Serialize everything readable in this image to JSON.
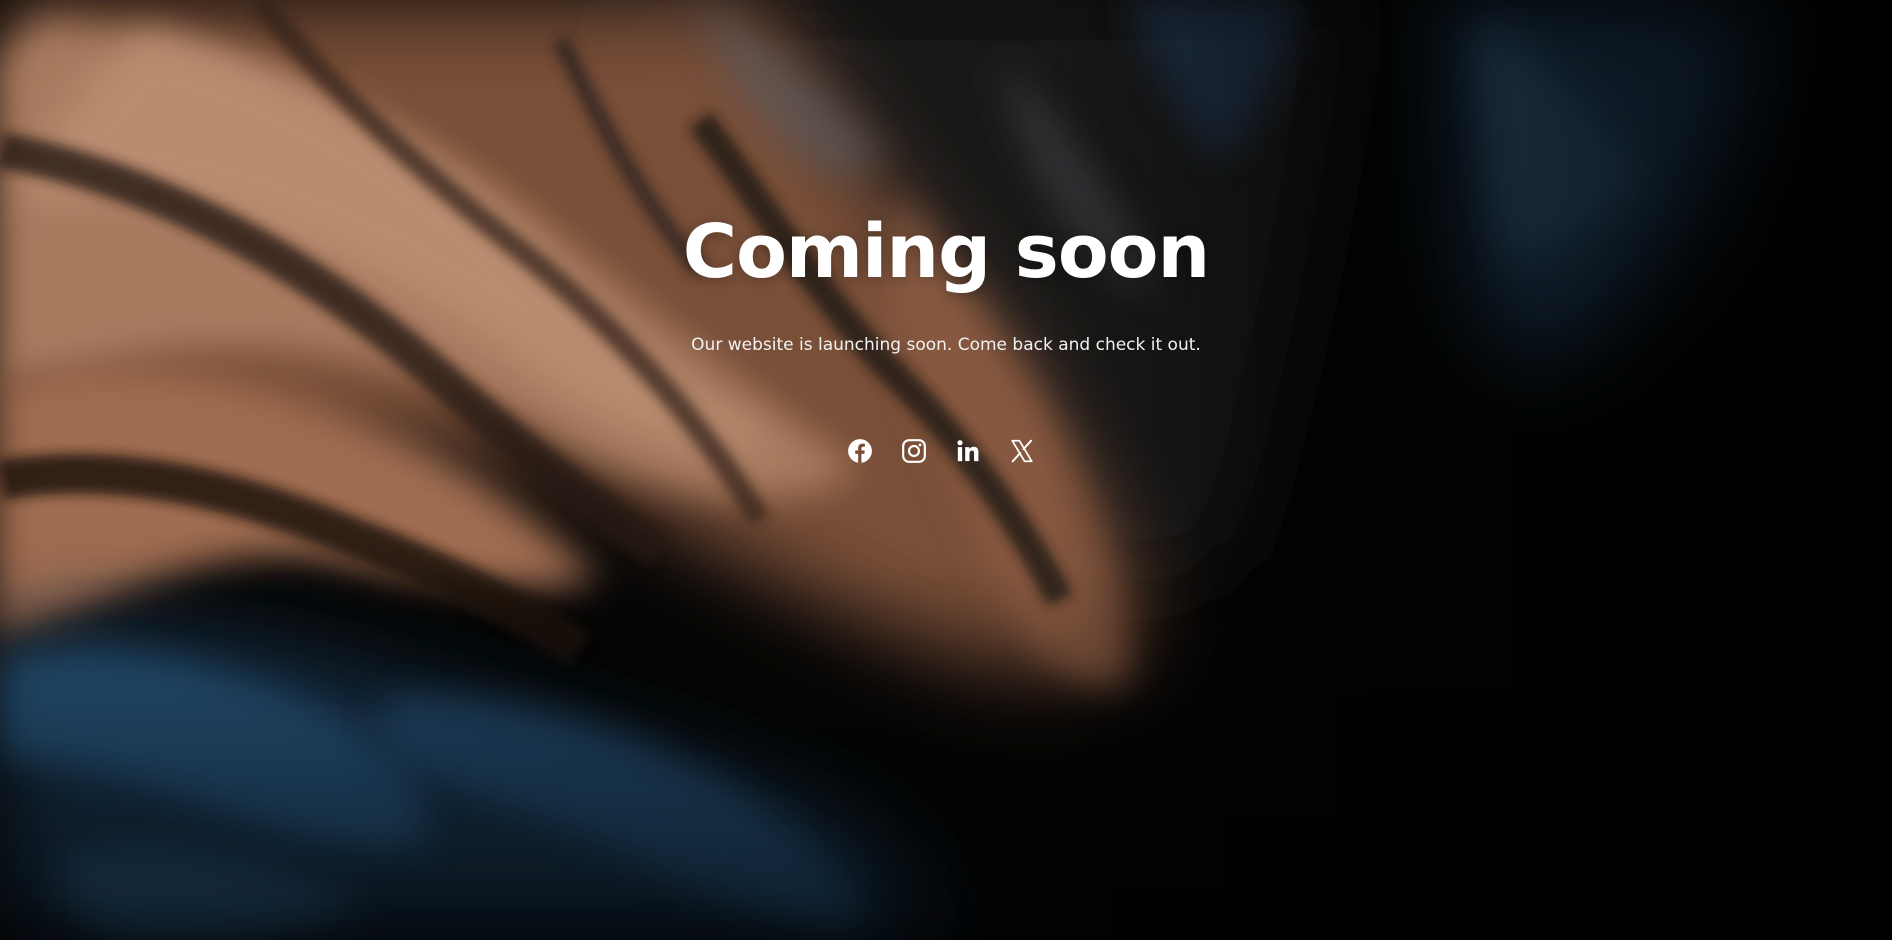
{
  "hero": {
    "title": "Coming soon",
    "subtitle": "Our website is launching soon. Come back and check it out."
  },
  "social": [
    {
      "name": "facebook",
      "icon": "facebook-icon"
    },
    {
      "name": "instagram",
      "icon": "instagram-icon"
    },
    {
      "name": "linkedin",
      "icon": "linkedin-icon"
    },
    {
      "name": "x",
      "icon": "x-icon"
    }
  ],
  "colors": {
    "text": "#ffffff",
    "background_dark": "#050505",
    "copper": "#b87a57",
    "blue": "#2e5f86"
  }
}
